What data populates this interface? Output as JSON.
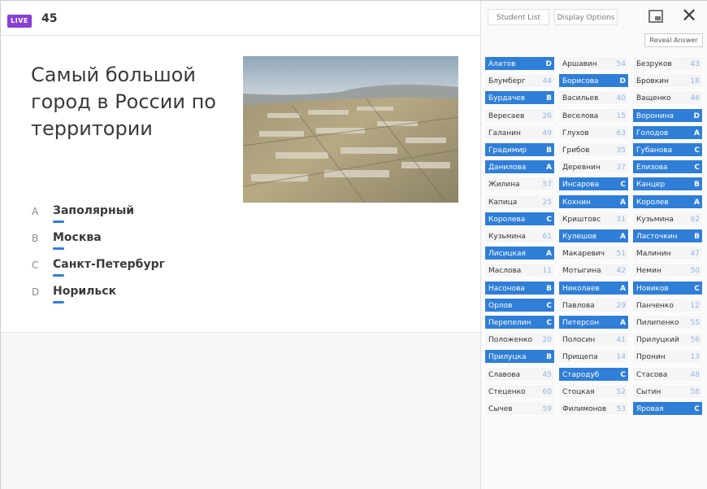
{
  "header": {
    "live_label": "LIVE",
    "count": "45"
  },
  "question": {
    "title": "Самый большой город в России по территории",
    "image_alt": "aerial city photo"
  },
  "answers": [
    {
      "letter": "A",
      "text": "Заполярный"
    },
    {
      "letter": "B",
      "text": "Москва"
    },
    {
      "letter": "C",
      "text": "Санкт-Петербург"
    },
    {
      "letter": "D",
      "text": "Норильск"
    }
  ],
  "panel": {
    "tab_students": "Student List",
    "tab_display": "Display Options",
    "reveal_label": "Reveal Answer",
    "colors": {
      "selected": "#2f7ed8",
      "unselected": "#f5f5f5"
    },
    "students": [
      {
        "name": "Алатов",
        "value": "D",
        "selected": true
      },
      {
        "name": "Аршавин",
        "value": "54",
        "selected": false
      },
      {
        "name": "Безруков",
        "value": "43",
        "selected": false
      },
      {
        "name": "Блумберг",
        "value": "44",
        "selected": false
      },
      {
        "name": "Борисова",
        "value": "D",
        "selected": true
      },
      {
        "name": "Бровкин",
        "value": "18",
        "selected": false
      },
      {
        "name": "Бурдачев",
        "value": "B",
        "selected": true
      },
      {
        "name": "Васильев",
        "value": "40",
        "selected": false
      },
      {
        "name": "Ващенко",
        "value": "46",
        "selected": false
      },
      {
        "name": "Вересаев",
        "value": "26",
        "selected": false
      },
      {
        "name": "Веселова",
        "value": "15",
        "selected": false
      },
      {
        "name": "Воронина",
        "value": "D",
        "selected": true
      },
      {
        "name": "Галанин",
        "value": "49",
        "selected": false
      },
      {
        "name": "Глухов",
        "value": "63",
        "selected": false
      },
      {
        "name": "Голодов",
        "value": "A",
        "selected": true
      },
      {
        "name": "Градимир",
        "value": "B",
        "selected": true
      },
      {
        "name": "Грибов",
        "value": "35",
        "selected": false
      },
      {
        "name": "Губанова",
        "value": "C",
        "selected": true
      },
      {
        "name": "Данилова",
        "value": "A",
        "selected": true
      },
      {
        "name": "Деревнин",
        "value": "37",
        "selected": false
      },
      {
        "name": "Елизова",
        "value": "C",
        "selected": true
      },
      {
        "name": "Жилина",
        "value": "57",
        "selected": false
      },
      {
        "name": "Инсарова",
        "value": "C",
        "selected": true
      },
      {
        "name": "Канцер",
        "value": "B",
        "selected": true
      },
      {
        "name": "Капица",
        "value": "25",
        "selected": false
      },
      {
        "name": "Кохнин",
        "value": "A",
        "selected": true
      },
      {
        "name": "Королев",
        "value": "A",
        "selected": true
      },
      {
        "name": "Королева",
        "value": "C",
        "selected": true
      },
      {
        "name": "Криштовс",
        "value": "31",
        "selected": false
      },
      {
        "name": "Кузьмина",
        "value": "62",
        "selected": false
      },
      {
        "name": "Кузьмина",
        "value": "61",
        "selected": false
      },
      {
        "name": "Кулешов",
        "value": "A",
        "selected": true
      },
      {
        "name": "Ласточкин",
        "value": "B",
        "selected": true
      },
      {
        "name": "Лисицкая",
        "value": "A",
        "selected": true
      },
      {
        "name": "Макаревич",
        "value": "51",
        "selected": false
      },
      {
        "name": "Малинин",
        "value": "47",
        "selected": false
      },
      {
        "name": "Маслова",
        "value": "11",
        "selected": false
      },
      {
        "name": "Мотыгина",
        "value": "42",
        "selected": false
      },
      {
        "name": "Немин",
        "value": "50",
        "selected": false
      },
      {
        "name": "Насонова",
        "value": "B",
        "selected": true
      },
      {
        "name": "Николаев",
        "value": "A",
        "selected": true
      },
      {
        "name": "Новиков",
        "value": "C",
        "selected": true
      },
      {
        "name": "Орлов",
        "value": "C",
        "selected": true
      },
      {
        "name": "Павлова",
        "value": "29",
        "selected": false
      },
      {
        "name": "Панченко",
        "value": "12",
        "selected": false
      },
      {
        "name": "Перепелин",
        "value": "C",
        "selected": true
      },
      {
        "name": "Петерсон",
        "value": "A",
        "selected": true
      },
      {
        "name": "Пилипенко",
        "value": "55",
        "selected": false
      },
      {
        "name": "Положенко",
        "value": "20",
        "selected": false
      },
      {
        "name": "Полосин",
        "value": "41",
        "selected": false
      },
      {
        "name": "Прилуцкий",
        "value": "56",
        "selected": false
      },
      {
        "name": "Прилуцка",
        "value": "B",
        "selected": true
      },
      {
        "name": "Прищепа",
        "value": "14",
        "selected": false
      },
      {
        "name": "Пронин",
        "value": "13",
        "selected": false
      },
      {
        "name": "Славова",
        "value": "45",
        "selected": false
      },
      {
        "name": "Стародуб",
        "value": "C",
        "selected": true
      },
      {
        "name": "Стасова",
        "value": "48",
        "selected": false
      },
      {
        "name": "Стеценко",
        "value": "60",
        "selected": false
      },
      {
        "name": "Стоцкая",
        "value": "52",
        "selected": false
      },
      {
        "name": "Сытин",
        "value": "58",
        "selected": false
      },
      {
        "name": "Сычев",
        "value": "59",
        "selected": false
      },
      {
        "name": "Филимонов",
        "value": "53",
        "selected": false
      },
      {
        "name": "Яровая",
        "value": "C",
        "selected": true
      }
    ]
  }
}
